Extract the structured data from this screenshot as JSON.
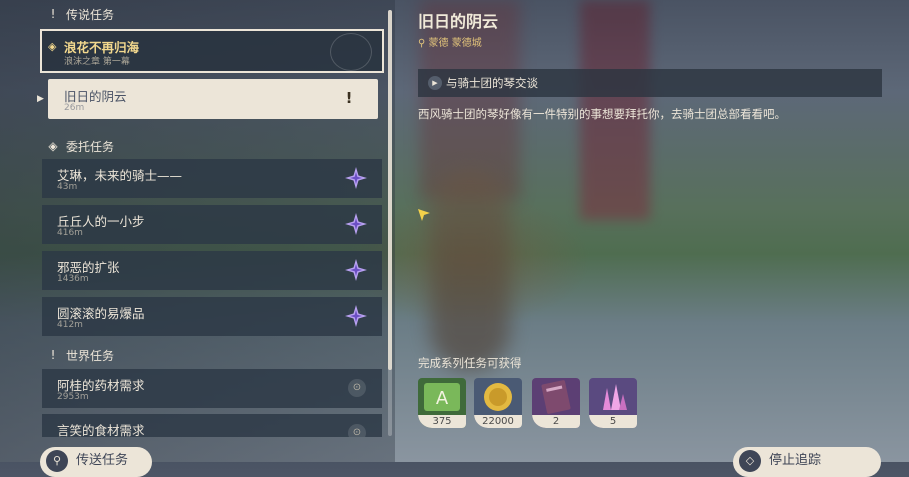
{
  "sections": {
    "archon": {
      "label": "传说任务",
      "icon": "exclamation-icon"
    },
    "commission": {
      "label": "委托任务",
      "icon": "commission-diamond-icon"
    },
    "world": {
      "label": "世界任务",
      "icon": "exclamation-icon"
    }
  },
  "archon_quest": {
    "title": "浪花不再归海",
    "subtitle": "浪沫之章 第一幕"
  },
  "active_subquest": {
    "title": "旧日的阴云",
    "distance": "26m"
  },
  "commissions": [
    {
      "title": "艾琳，未来的骑士——",
      "distance": "43m"
    },
    {
      "title": "丘丘人的一小步",
      "distance": "416m"
    },
    {
      "title": "邪恶的扩张",
      "distance": "1436m"
    },
    {
      "title": "圆滚滚的易爆品",
      "distance": "412m"
    }
  ],
  "world_quests": [
    {
      "title": "阿桂的药材需求",
      "distance": "2953m"
    },
    {
      "title": "言笑的食材需求",
      "distance": ""
    }
  ],
  "detail": {
    "title": "旧日的阴云",
    "location": "蒙德 蒙德城",
    "objective": "与骑士团的琴交谈",
    "description": "西风骑士团的琴好像有一件特别的事想要拜托你，去骑士团总部看看吧。",
    "rewards_label": "完成系列任务可获得",
    "rewards": [
      {
        "name": "adventure-exp",
        "count": "375",
        "color": "#5a9a48"
      },
      {
        "name": "mora",
        "count": "22000",
        "color": "#c9a23a"
      },
      {
        "name": "heros-wit",
        "count": "2",
        "color": "#7a4e86"
      },
      {
        "name": "crystal",
        "count": "5",
        "color": "#8a6aa8"
      }
    ]
  },
  "buttons": {
    "teleport": "传送任务",
    "stop_tracking": "停止追踪"
  },
  "colors": {
    "accent_gold": "#f3d98e",
    "panel_light": "#ece5d8",
    "panel_dark": "#2c3846"
  }
}
